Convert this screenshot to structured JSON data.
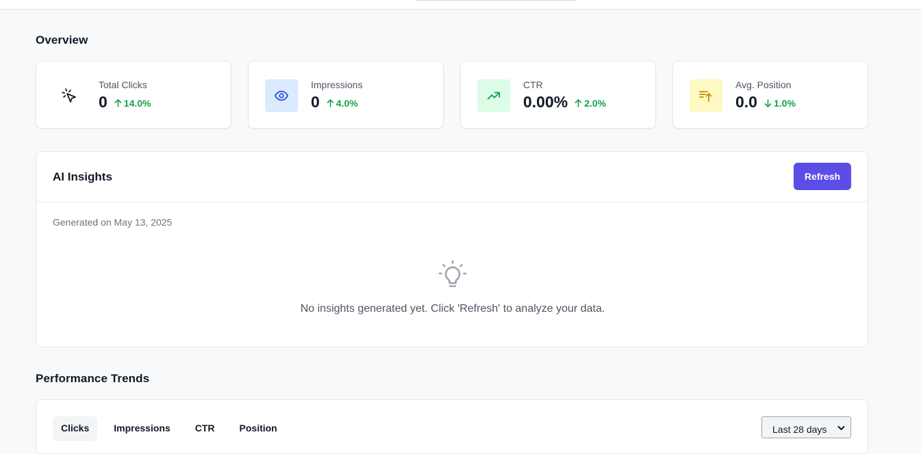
{
  "overview": {
    "title": "Overview",
    "cards": [
      {
        "label": "Total Clicks",
        "value": "0",
        "change": "14.0%",
        "direction": "up",
        "icon": "cursor-click-icon",
        "icon_bg": "#ffffff",
        "icon_color": "#111827"
      },
      {
        "label": "Impressions",
        "value": "0",
        "change": "4.0%",
        "direction": "up",
        "icon": "eye-icon",
        "icon_bg": "#dbeafe",
        "icon_color": "#1d4ed8"
      },
      {
        "label": "CTR",
        "value": "0.00%",
        "change": "2.0%",
        "direction": "up",
        "icon": "trending-up-icon",
        "icon_bg": "#dcfce7",
        "icon_color": "#16a34a"
      },
      {
        "label": "Avg. Position",
        "value": "0.0",
        "change": "1.0%",
        "direction": "down",
        "icon": "sort-ascending-icon",
        "icon_bg": "#fef9c3",
        "icon_color": "#ca8a04"
      }
    ]
  },
  "insights": {
    "title": "AI Insights",
    "refresh_label": "Refresh",
    "generated_on": "Generated on May 13, 2025",
    "empty_icon": "lightbulb-icon",
    "empty_text": "No insights generated yet. Click 'Refresh' to analyze your data."
  },
  "trends": {
    "title": "Performance Trends",
    "tabs": [
      "Clicks",
      "Impressions",
      "CTR",
      "Position"
    ],
    "active_tab": "Clicks",
    "range": "Last 28 days"
  },
  "colors": {
    "accent": "#5b4ee6",
    "positive": "#16a34a",
    "background": "#f8f9fb"
  }
}
